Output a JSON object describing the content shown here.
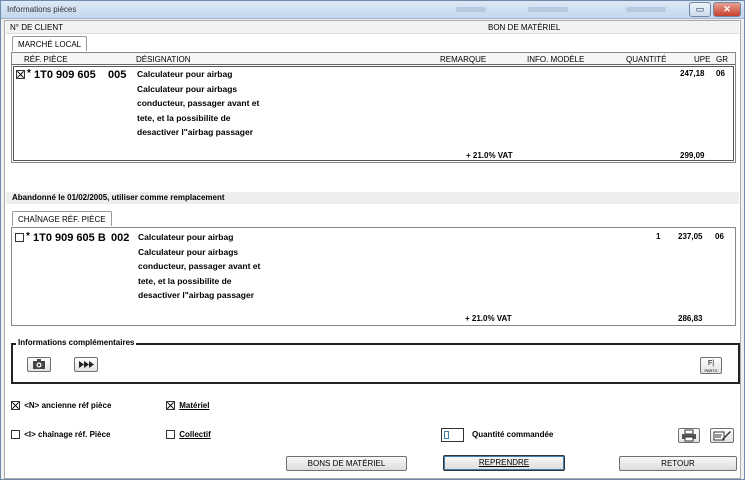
{
  "window": {
    "title": "Informations pièces"
  },
  "header": {
    "client_label": "N° DE CLIENT",
    "bon_label": "BON DE MATÉRIEL"
  },
  "tabs": {
    "local": "MARCHÉ LOCAL",
    "chain": "CHAÎNAGE RÉF. PIÈCE"
  },
  "columns": {
    "ref": "RÉF. PIÈCE",
    "designation": "DÉSIGNATION",
    "remarque": "REMARQUE",
    "info": "INFO. MODÈLE",
    "qty": "QUANTITÉ",
    "upe": "UPE",
    "gr": "GR"
  },
  "part1": {
    "ref": "1T0 909 605",
    "suffix": "005",
    "star": "*",
    "desc": [
      "Calculateur pour airbag",
      "Calculateur pour airbags",
      "conducteur, passager avant et",
      "tete, et la possibilite de",
      "desactiver l\"airbag passager"
    ],
    "price": "247,18",
    "gr": "06",
    "vat_label": "+ 21.0% VAT",
    "vat_price": "299,09"
  },
  "abandon_text": "Abandonné le 01/02/2005, utiliser comme remplacement",
  "part2": {
    "ref": "1T0 909 605 B",
    "suffix": "002",
    "star": "*",
    "desc": [
      "Calculateur pour airbag",
      "Calculateur pour airbags",
      "conducteur, passager avant et",
      "tete, et la possibilite de",
      "desactiver l\"airbag passager"
    ],
    "qty": "1",
    "price": "237,05",
    "gr": "06",
    "vat_label": "+ 21.0% VAT",
    "vat_price": "286,83"
  },
  "info": {
    "label": "Informations complémentaires",
    "fi_label": "F|",
    "fi_sub": "PARTS"
  },
  "options": {
    "ancienne": "<N> ancienne réf pièce",
    "materiel": "Matériel",
    "chainage": "<I> chaînage réf. Pièce",
    "collectif": "Collectif",
    "qty_label": "Quantité commandée"
  },
  "buttons": {
    "bons": "BONS DE MATÉRIEL",
    "reprendre": "REPRENDRE",
    "retour": "RETOUR"
  }
}
